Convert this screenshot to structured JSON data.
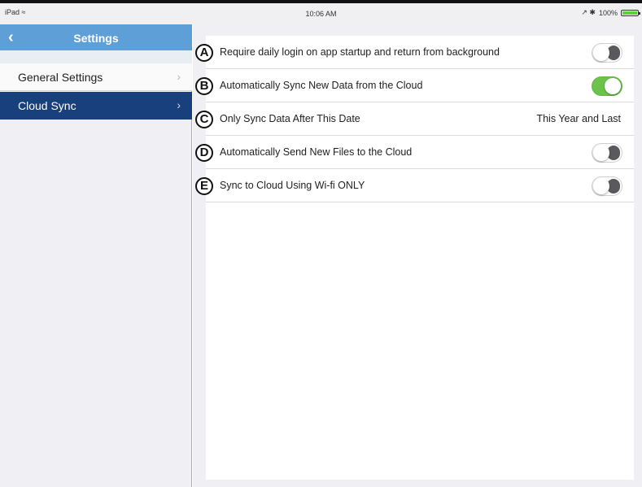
{
  "status_bar": {
    "device": "iPad",
    "wifi_icon": "wifi-icon",
    "time": "10:06 AM",
    "battery_text": "100%",
    "indicators": "↗ ✱"
  },
  "sidebar": {
    "title": "Settings",
    "back_icon": "chevron-left-icon",
    "items": [
      {
        "label": "General Settings",
        "chevron": "›"
      },
      {
        "label": "Cloud Sync",
        "chevron": "›"
      }
    ]
  },
  "settings": {
    "rows": [
      {
        "marker": "A",
        "label": "Require daily login on app startup and return from background",
        "toggle": "off"
      },
      {
        "marker": "B",
        "label": "Automatically Sync New Data from the Cloud",
        "toggle": "on"
      },
      {
        "marker": "C",
        "label": "Only Sync Data After This Date",
        "value": "This Year and Last"
      },
      {
        "marker": "D",
        "label": "Automatically Send New Files to the Cloud",
        "toggle": "off"
      },
      {
        "marker": "E",
        "label": "Sync to Cloud Using Wi-fi ONLY",
        "toggle": "off"
      }
    ]
  },
  "colors": {
    "accent": "#5e9fd8",
    "selected": "#17407c",
    "toggle_on": "#6dc14d"
  }
}
